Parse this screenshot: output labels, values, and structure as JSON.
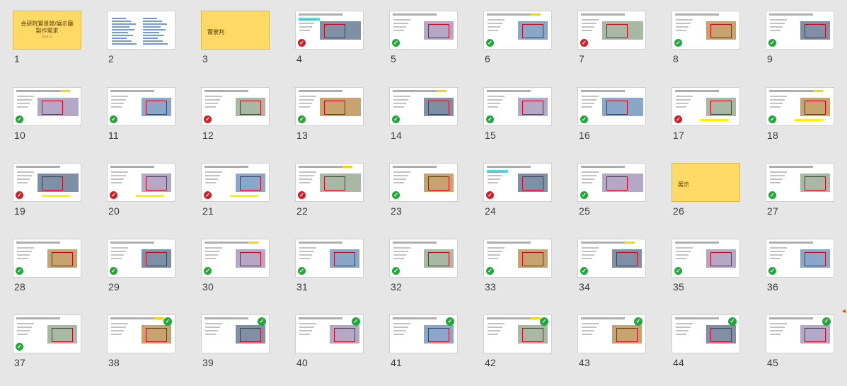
{
  "slides": [
    {
      "number": "1",
      "kind": "title",
      "title_lines": [
        "会研院實景館/展示廳",
        "製作需求"
      ],
      "subtitle": "2023.04"
    },
    {
      "number": "2",
      "kind": "toc"
    },
    {
      "number": "3",
      "kind": "section",
      "label": "實景判"
    },
    {
      "number": "4",
      "kind": "photo",
      "badge": "bad"
    },
    {
      "number": "5",
      "kind": "photo",
      "badge": "ok"
    },
    {
      "number": "6",
      "kind": "photo",
      "badge": "ok"
    },
    {
      "number": "7",
      "kind": "photo",
      "badge": "bad"
    },
    {
      "number": "8",
      "kind": "photo",
      "badge": "ok"
    },
    {
      "number": "9",
      "kind": "photo",
      "badge": "ok"
    },
    {
      "number": "10",
      "kind": "photo",
      "badge": "ok"
    },
    {
      "number": "11",
      "kind": "photo",
      "badge": "ok"
    },
    {
      "number": "12",
      "kind": "photo",
      "badge": "bad"
    },
    {
      "number": "13",
      "kind": "photo",
      "badge": "ok"
    },
    {
      "number": "14",
      "kind": "photo",
      "badge": "ok"
    },
    {
      "number": "15",
      "kind": "photo",
      "badge": "ok"
    },
    {
      "number": "16",
      "kind": "photo",
      "badge": "ok"
    },
    {
      "number": "17",
      "kind": "photo",
      "badge": "bad"
    },
    {
      "number": "18",
      "kind": "photo",
      "badge": "ok"
    },
    {
      "number": "19",
      "kind": "photo",
      "badge": "bad"
    },
    {
      "number": "20",
      "kind": "photo",
      "badge": "bad"
    },
    {
      "number": "21",
      "kind": "photo",
      "badge": "bad"
    },
    {
      "number": "22",
      "kind": "photo",
      "badge": "bad"
    },
    {
      "number": "23",
      "kind": "photo",
      "badge": "ok"
    },
    {
      "number": "24",
      "kind": "photo",
      "badge": "bad"
    },
    {
      "number": "25",
      "kind": "photo",
      "badge": "ok"
    },
    {
      "number": "26",
      "kind": "section",
      "label": "展示"
    },
    {
      "number": "27",
      "kind": "photo",
      "badge": "ok"
    },
    {
      "number": "28",
      "kind": "photo",
      "badge": "ok"
    },
    {
      "number": "29",
      "kind": "photo",
      "badge": "ok"
    },
    {
      "number": "30",
      "kind": "photo",
      "badge": "ok"
    },
    {
      "number": "31",
      "kind": "photo",
      "badge": "ok"
    },
    {
      "number": "32",
      "kind": "photo",
      "badge": "ok"
    },
    {
      "number": "33",
      "kind": "photo",
      "badge": "ok"
    },
    {
      "number": "34",
      "kind": "photo",
      "badge": "ok"
    },
    {
      "number": "35",
      "kind": "photo",
      "badge": "ok"
    },
    {
      "number": "36",
      "kind": "photo",
      "badge": "ok"
    },
    {
      "number": "37",
      "kind": "photo",
      "badge": "ok"
    },
    {
      "number": "38",
      "kind": "photo",
      "badge": "ok_top"
    },
    {
      "number": "39",
      "kind": "photo",
      "badge": "ok_top"
    },
    {
      "number": "40",
      "kind": "photo",
      "badge": "ok_top"
    },
    {
      "number": "41",
      "kind": "photo",
      "badge": "ok_top"
    },
    {
      "number": "42",
      "kind": "photo",
      "badge": "ok_top"
    },
    {
      "number": "43",
      "kind": "photo",
      "badge": "ok_top"
    },
    {
      "number": "44",
      "kind": "photo",
      "badge": "ok_top"
    },
    {
      "number": "45",
      "kind": "photo",
      "badge": "ok_top"
    }
  ],
  "colors": {
    "background": "#e6e6e6",
    "title_slide": "#ffd966",
    "ok_badge": "#22a83a",
    "bad_badge": "#d0202a",
    "highlight_red": "#d0021b"
  },
  "icons": {
    "ok": "check-circle-icon",
    "bad": "x-circle-icon"
  }
}
